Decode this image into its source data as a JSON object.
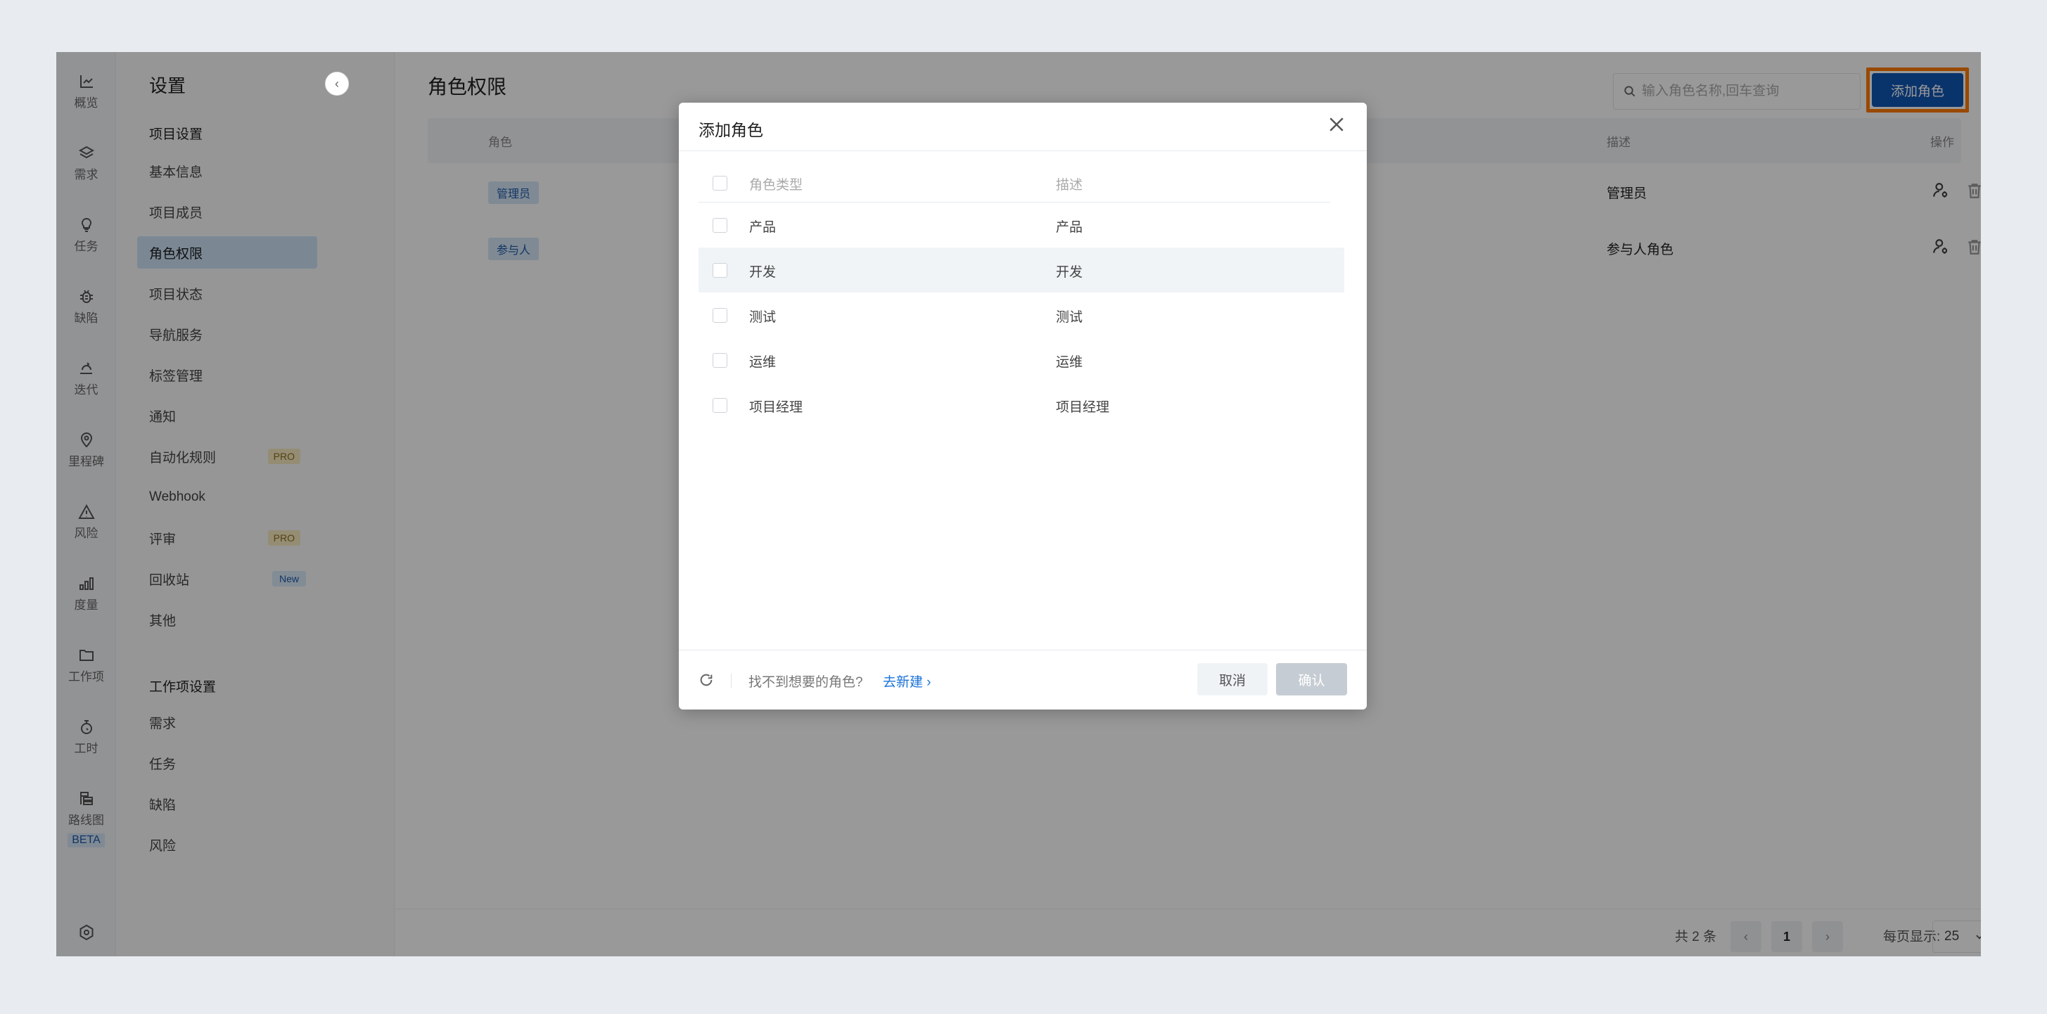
{
  "rail": {
    "items": [
      {
        "label": "概览",
        "icon": "chart-line-icon"
      },
      {
        "label": "需求",
        "icon": "layers-icon"
      },
      {
        "label": "任务",
        "icon": "lightbulb-icon"
      },
      {
        "label": "缺陷",
        "icon": "bug-icon"
      },
      {
        "label": "迭代",
        "icon": "iteration-icon"
      },
      {
        "label": "里程碑",
        "icon": "map-pin-icon"
      },
      {
        "label": "风险",
        "icon": "warning-icon"
      },
      {
        "label": "度量",
        "icon": "bar-chart-icon"
      },
      {
        "label": "工作项",
        "icon": "folder-icon"
      },
      {
        "label": "工时",
        "icon": "stopwatch-icon"
      },
      {
        "label": "路线图",
        "icon": "roadmap-icon",
        "badge": "BETA"
      }
    ],
    "settings_icon": "settings-hex-icon"
  },
  "menu": {
    "title": "设置",
    "group1": "项目设置",
    "items1": [
      {
        "label": "基本信息"
      },
      {
        "label": "项目成员"
      },
      {
        "label": "角色权限",
        "active": true
      },
      {
        "label": "项目状态"
      },
      {
        "label": "导航服务"
      },
      {
        "label": "标签管理"
      },
      {
        "label": "通知"
      },
      {
        "label": "自动化规则",
        "badge": "PRO"
      },
      {
        "label": "Webhook"
      },
      {
        "label": "评审",
        "badge": "PRO"
      },
      {
        "label": "回收站",
        "badge": "New"
      },
      {
        "label": "其他"
      }
    ],
    "group2": "工作项设置",
    "items2": [
      {
        "label": "需求"
      },
      {
        "label": "任务"
      },
      {
        "label": "缺陷"
      },
      {
        "label": "风险"
      }
    ]
  },
  "main": {
    "title": "角色权限",
    "search_placeholder": "输入角色名称,回车查询",
    "add_button": "添加角色",
    "columns": {
      "role": "角色",
      "desc": "描述",
      "action": "操作"
    },
    "rows": [
      {
        "role": "管理员",
        "desc": "管理员"
      },
      {
        "role": "参与人",
        "desc": "参与人角色"
      }
    ],
    "pagination": {
      "total": "共 2 条",
      "prev": "‹",
      "current": "1",
      "next": "›",
      "page_size_label": "每页显示:",
      "page_size": "25"
    }
  },
  "modal": {
    "title": "添加角色",
    "columns": {
      "type": "角色类型",
      "desc": "描述"
    },
    "rows": [
      {
        "type": "产品",
        "desc": "产品"
      },
      {
        "type": "开发",
        "desc": "开发",
        "hover": true
      },
      {
        "type": "测试",
        "desc": "测试"
      },
      {
        "type": "运维",
        "desc": "运维"
      },
      {
        "type": "项目经理",
        "desc": "项目经理"
      }
    ],
    "footer_text": "找不到想要的角色?",
    "footer_link": "去新建 ›",
    "cancel": "取消",
    "confirm": "确认"
  },
  "colors": {
    "primary": "#0f56b3",
    "highlight": "#ff7a00",
    "link": "#1a73d9"
  }
}
